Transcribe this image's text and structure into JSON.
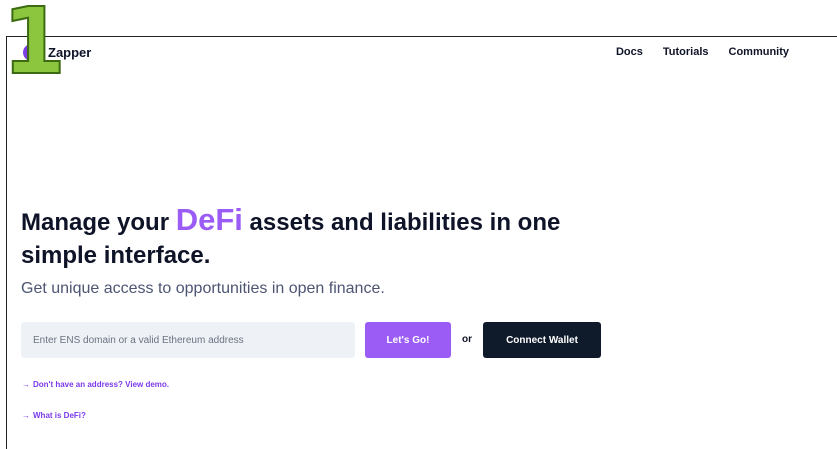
{
  "badge": {
    "number": "1"
  },
  "header": {
    "brand": "Zapper",
    "nav": [
      "Docs",
      "Tutorials",
      "Community"
    ]
  },
  "hero": {
    "headline_before": "Manage your ",
    "headline_accent": "DeFi",
    "headline_after": " assets and liabilities in one simple interface.",
    "subline": "Get unique access to opportunities in open finance."
  },
  "form": {
    "address_placeholder": "Enter ENS domain or a valid Ethereum address",
    "go_label": "Let's Go!",
    "or_text": "or",
    "wallet_label": "Connect Wallet"
  },
  "links": {
    "arrow": "→",
    "demo": "Don't have an address? View demo.",
    "what_is_defi": "What is DeFi?"
  },
  "colors": {
    "accent": "#9b5cf6",
    "dark": "#0f1a2b",
    "badge": "#8cc63f"
  }
}
